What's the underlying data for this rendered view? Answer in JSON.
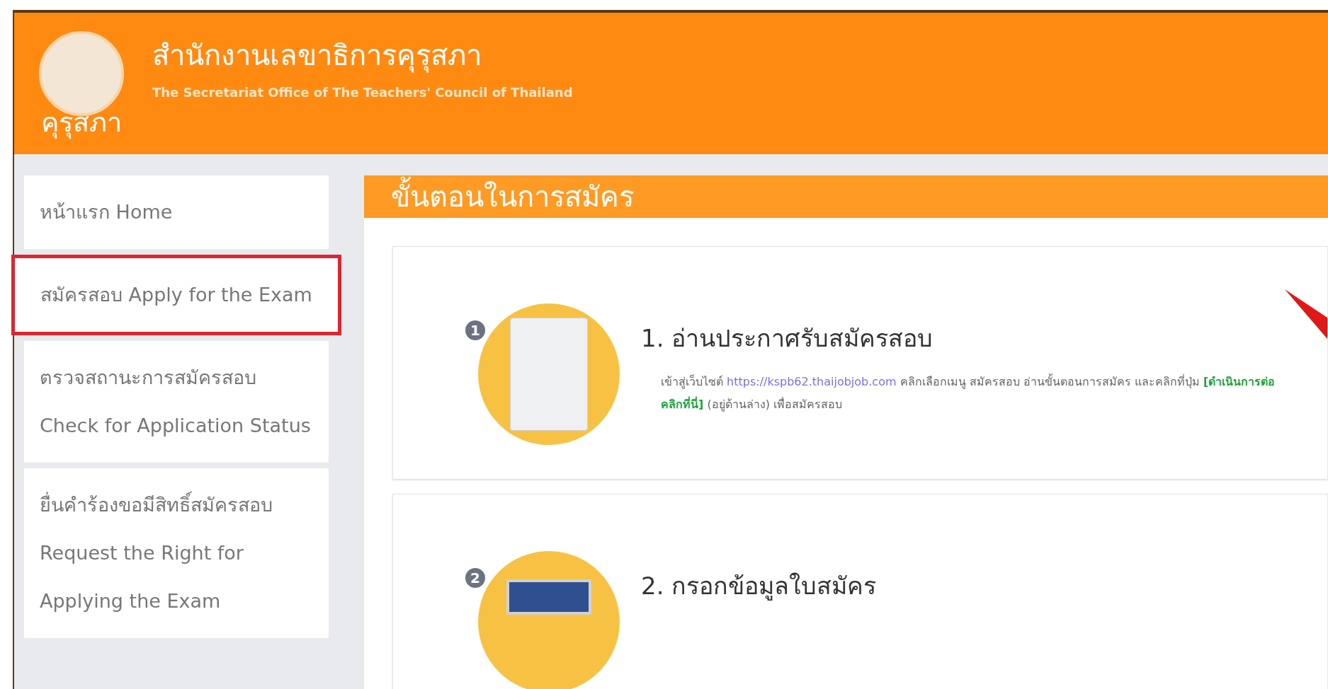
{
  "header": {
    "logo_text": "คุรุสภา",
    "title": "สำนักงานเลขาธิการคุรุสภา",
    "subtitle": "The Secretariat Office of The Teachers' Council of Thailand"
  },
  "sidebar": {
    "items": [
      {
        "label": "หน้าแรก Home",
        "selected": false
      },
      {
        "label": "สมัครสอบ Apply for the Exam",
        "selected": true
      },
      {
        "label": "ตรวจสถานะการสมัครสอบ Check for Application Status",
        "selected": false
      },
      {
        "label": "ยื่นคำร้องขอมีสิทธิ์สมัครสอบ Request the Right for Applying the Exam",
        "selected": false
      }
    ]
  },
  "panel": {
    "title": "ขั้นตอนในการสมัคร",
    "steps": [
      {
        "number": "1",
        "kind": "document",
        "title": "1. อ่านประกาศรับสมัครสอบ",
        "text_before": "เข้าสู่เว็บไซต์",
        "link": "https://kspb62.thaijobjob.com",
        "text_middle": "คลิกเลือกเมนู สมัครสอบ อ่านขั้นตอนการสมัคร และคลิกที่ปุ่ม",
        "highlight": "[ดำเนินการต่อคลิกที่นี่]",
        "text_after": "(อยู่ด้านล่าง) เพื่อสมัครสอบ"
      },
      {
        "number": "2",
        "kind": "form",
        "title": "2. กรอกข้อมูลใบสมัคร"
      }
    ]
  }
}
